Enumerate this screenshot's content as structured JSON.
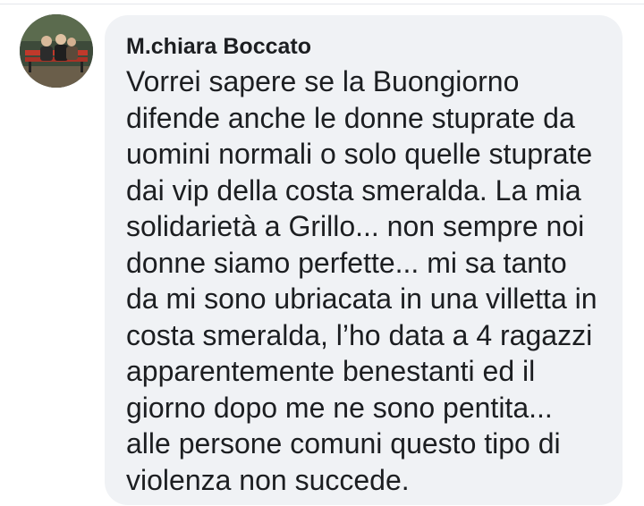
{
  "comment": {
    "avatar_icon": "user-photo-avatar",
    "author": "M.chiara Boccato",
    "lines": [
      "Vorrei sapere se la Buongiorno",
      "difende anche le donne stuprate da",
      "uomini normali o solo quelle stuprate",
      "dai vip della costa smeralda. La mia",
      "solidarietà a Grillo... non sempre noi",
      "donne siamo perfette... mi sa tanto",
      "da mi sono ubriacata in una villetta in",
      "costa smeralda, l’ho data a 4 ragazzi",
      "apparentemente benestanti ed il",
      "giorno dopo me ne sono pentita...",
      "alle persone comuni questo tipo di",
      "violenza non succede."
    ]
  },
  "colors": {
    "bubble_bg": "#f0f2f5",
    "text": "#1c1e21"
  }
}
